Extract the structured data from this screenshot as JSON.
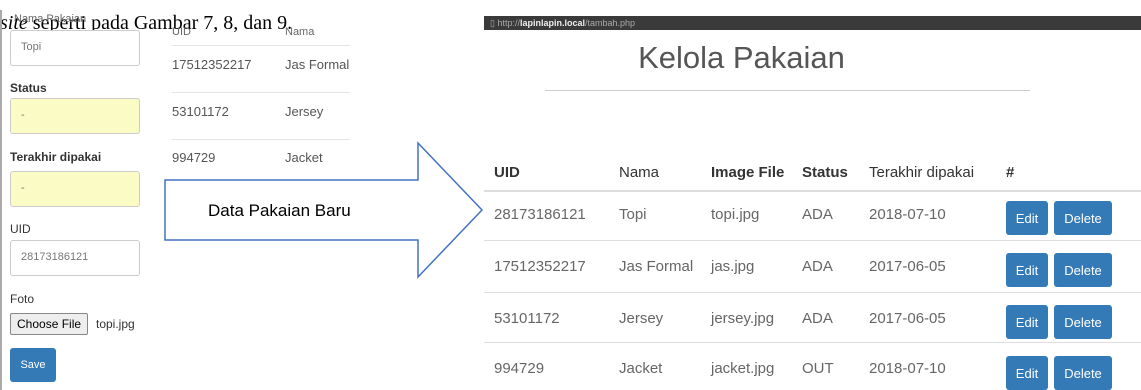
{
  "caption": {
    "italic": "site",
    "text": " seperti pada Gambar 7, 8, dan 9."
  },
  "overlap": {
    "a": "Nama Pakaian",
    "b": "UID",
    "c": "Nama"
  },
  "form": {
    "name_value": "Topi",
    "status_label": "Status",
    "status_value": "-",
    "last_used_label": "Terakhir dipakai",
    "last_used_value": "-",
    "uid_label": "UID",
    "uid_value": "28173186121",
    "photo_label": "Foto",
    "choose_file_label": "Choose File",
    "file_name": "topi.jpg",
    "save_label": "Save"
  },
  "middle_list": [
    {
      "uid": "17512352217",
      "nama": "Jas Formal"
    },
    {
      "uid": "53101172",
      "nama": "Jersey"
    },
    {
      "uid": "994729",
      "nama": "Jacket"
    }
  ],
  "arrow_label": "Data Pakaian Baru",
  "browser": {
    "url_prefix": "http://",
    "url_host": "lapinlapin.local",
    "url_path": "/tambah.php",
    "title": "Kelola Pakaian"
  },
  "table": {
    "headers": {
      "uid": "UID",
      "nama": "Nama",
      "image": "Image File",
      "status": "Status",
      "terakhir": "Terakhir dipakai",
      "action": "#"
    },
    "rows": [
      {
        "uid": "28173186121",
        "nama": "Topi",
        "image": "topi.jpg",
        "status": "ADA",
        "date": "2018-07-10"
      },
      {
        "uid": "17512352217",
        "nama": "Jas Formal",
        "image": "jas.jpg",
        "status": "ADA",
        "date": "2017-06-05"
      },
      {
        "uid": "53101172",
        "nama": "Jersey",
        "image": "jersey.jpg",
        "status": "ADA",
        "date": "2017-06-05"
      },
      {
        "uid": "994729",
        "nama": "Jacket",
        "image": "jacket.jpg",
        "status": "OUT",
        "date": "2018-07-10"
      }
    ],
    "edit_label": "Edit",
    "delete_label": "Delete"
  },
  "colors": {
    "primary": "#337ab7",
    "highlight_input": "#fbfbc6",
    "browser_bar": "#3a3a3a"
  }
}
